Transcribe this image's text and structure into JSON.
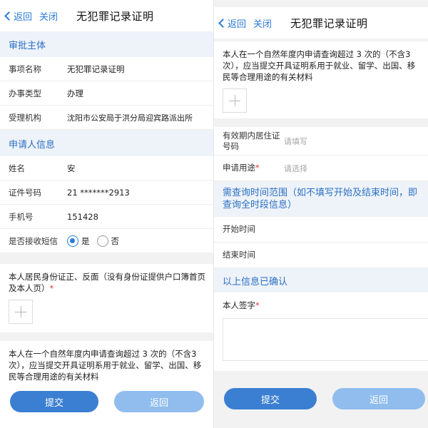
{
  "left": {
    "nav": {
      "back": "返回",
      "close": "关闭",
      "title": "无犯罪记录证明"
    },
    "approval_header": "审批主体",
    "approval_rows": [
      {
        "label": "事项名称",
        "value": "无犯罪记录证明"
      },
      {
        "label": "办事类型",
        "value": "办理"
      },
      {
        "label": "受理机构",
        "value": "沈阳市公安局于洪分局迎宾路派出所"
      }
    ],
    "applicant_header": "申请人信息",
    "applicant_rows": [
      {
        "label": "姓名",
        "value": "安"
      },
      {
        "label": "证件号码",
        "value": "21       *******2913"
      },
      {
        "label": "手机号",
        "value": "151428"
      }
    ],
    "sms": {
      "label": "是否接收短信",
      "yes": "是",
      "no": "否",
      "selected": "是"
    },
    "id_upload": {
      "text": "本人居民身份证正、反面（没有身份证提供户口簿首页及本人页）",
      "required_mark": "*"
    },
    "query_notice": "本人在一个自然年度内申请查询超过 3 次的（不含3次），应当提交开具证明系用于就业、留学、出国、移民等合理用途的有关材料",
    "buttons": {
      "submit": "提交",
      "back": "返回"
    }
  },
  "right": {
    "nav": {
      "back": "返回",
      "close": "关闭",
      "title": "无犯罪记录证明"
    },
    "query_notice": "本人在一个自然年度内申请查询超过 3 次的（不含3次），应当提交开具证明系用于就业、留学、出国、移民等合理用途的有关材料",
    "residence": {
      "label": "有效期内居住证号码",
      "placeholder": "请填写"
    },
    "purpose": {
      "label": "申请用途",
      "required_mark": "*",
      "placeholder": "请选择"
    },
    "time_range_header": "需查询时间范围（如不填写开始及结束时间，即查询全时段信息）",
    "start_time": {
      "label": "开始时间"
    },
    "end_time": {
      "label": "结束时间"
    },
    "confirmed_header": "以上信息已确认",
    "signature": {
      "label": "本人签字",
      "required_mark": "*"
    },
    "buttons": {
      "submit": "提交",
      "back": "返回"
    }
  },
  "colors": {
    "accent": "#2b7bd6",
    "section_bg": "#eef3fa",
    "button_primary": "#3a7fd2",
    "button_light": "#90bdee",
    "required": "#e23b3b"
  }
}
